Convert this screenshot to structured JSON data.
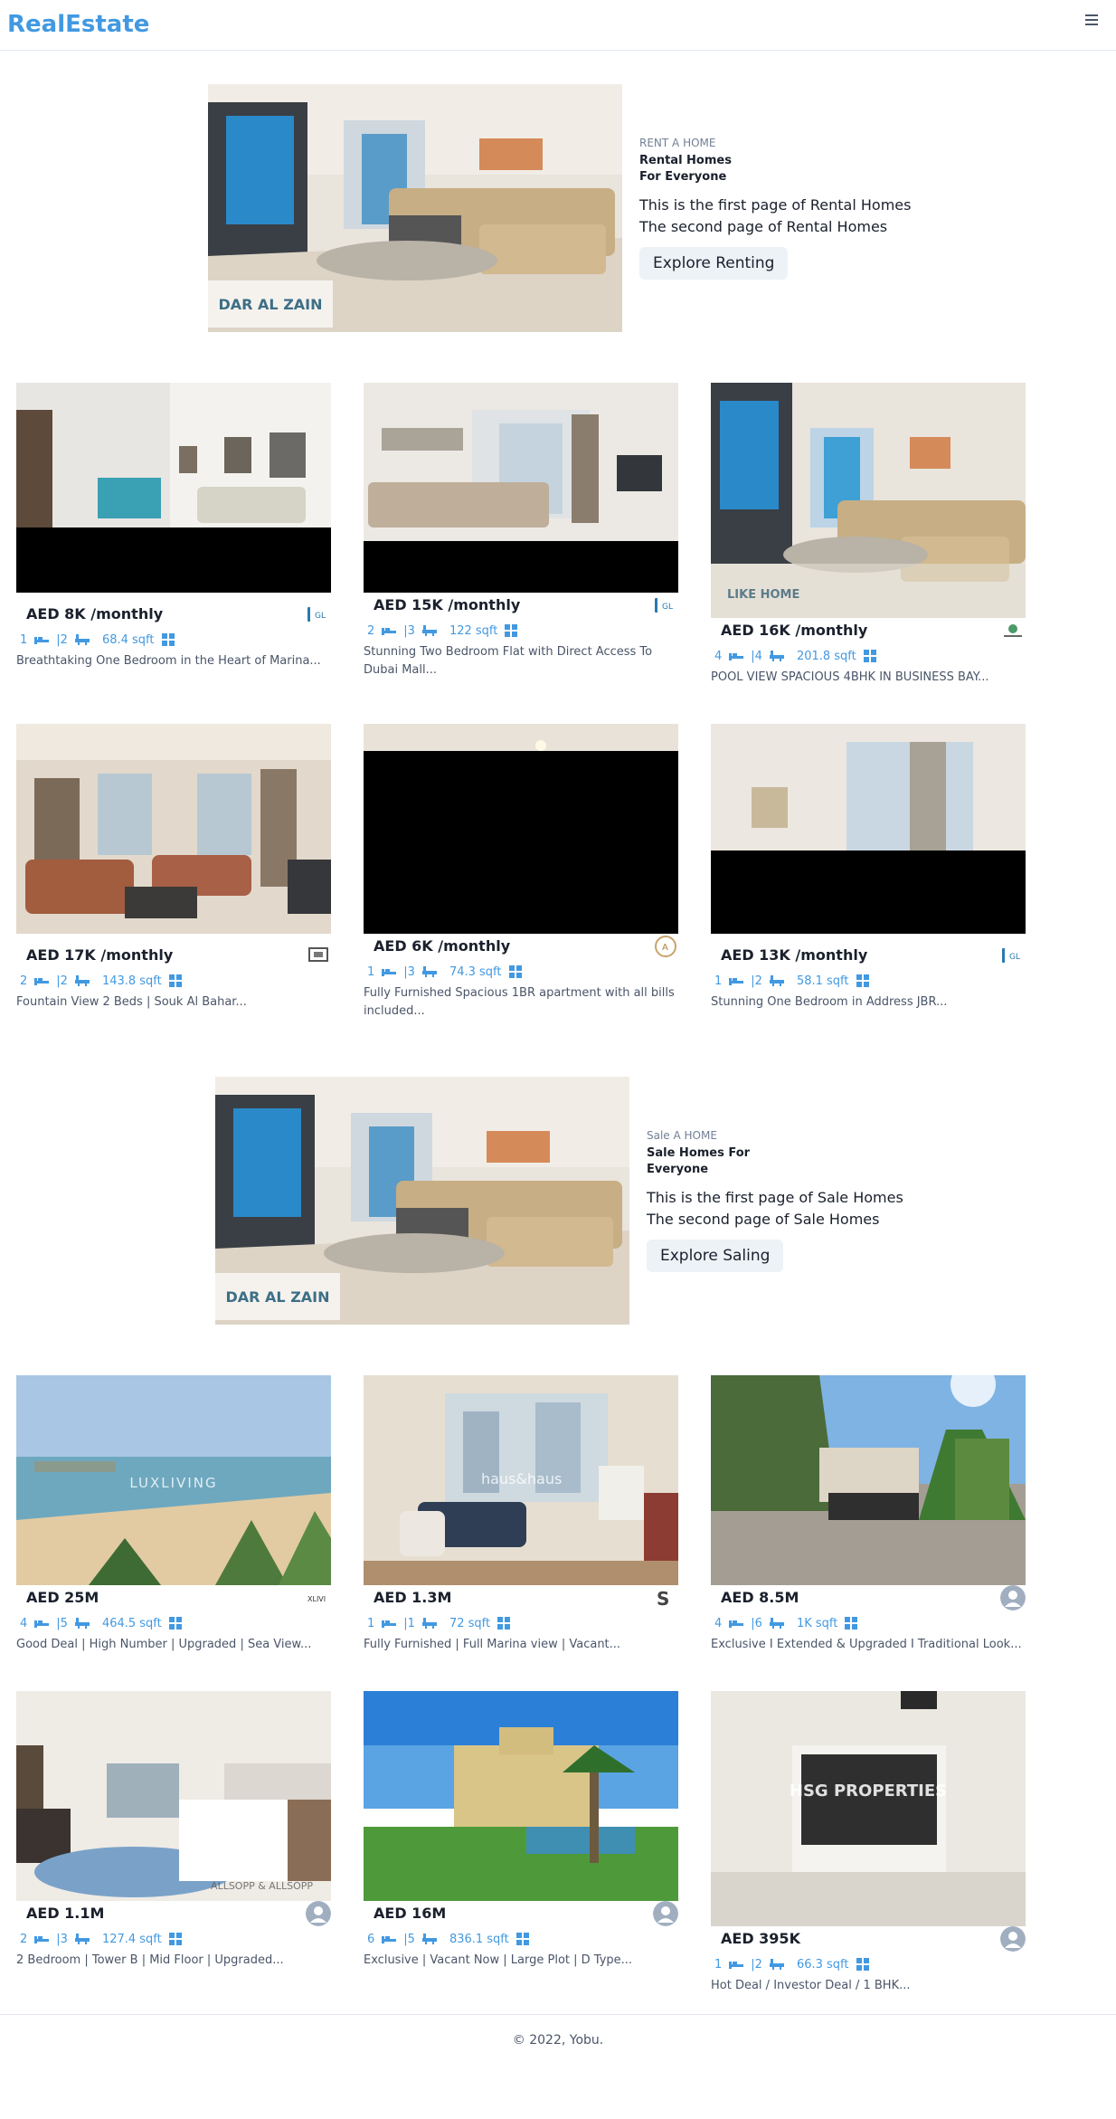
{
  "navbar": {
    "logo": "RealEstate",
    "menu_icon": "hamburger-icon"
  },
  "rent_banner": {
    "purpose": "RENT A HOME",
    "title": "Rental Homes For Everyone",
    "desc1": "This is the first page of Rental Homes",
    "desc2": "The second page of Rental Homes",
    "button": "Explore Renting",
    "watermark": "DAR AL ZAIN"
  },
  "sale_banner": {
    "purpose": "Sale A HOME",
    "title": "Sale Homes For Everyone",
    "desc1": "This is the first page of Sale Homes",
    "desc2": "The second page of Sale Homes",
    "button": "Explore Saling",
    "watermark": "DAR AL ZAIN"
  },
  "rent_cards": [
    {
      "price": "AED 8K /monthly",
      "rooms": "1",
      "baths": "|2",
      "area": "68.4 sqft",
      "title": "Breathtaking One Bedroom in the Heart of Marina...",
      "agency": "logo"
    },
    {
      "price": "AED 15K /monthly",
      "rooms": "2",
      "baths": "|3",
      "area": "122 sqft",
      "title": "Stunning Two Bedroom Flat with Direct Access To Dubai Mall...",
      "agency": "logo"
    },
    {
      "price": "AED 16K /monthly",
      "rooms": "4",
      "baths": "|4",
      "area": "201.8 sqft",
      "title": "POOL VIEW SPACIOUS 4BHK IN BUSINESS BAY...",
      "agency": "logo",
      "watermark": "LIKE HOME"
    },
    {
      "price": "AED 17K /monthly",
      "rooms": "2",
      "baths": "|2",
      "area": "143.8 sqft",
      "title": "Fountain View 2 Beds | Souk Al Bahar...",
      "agency": "logo"
    },
    {
      "price": "AED 6K /monthly",
      "rooms": "1",
      "baths": "|3",
      "area": "74.3 sqft",
      "title": "Fully Furnished Spacious 1BR apartment with all bills included...",
      "agency": "logo"
    },
    {
      "price": "AED 13K /monthly",
      "rooms": "1",
      "baths": "|2",
      "area": "58.1 sqft",
      "title": "Stunning One Bedroom in Address JBR...",
      "agency": "logo"
    }
  ],
  "sale_cards": [
    {
      "price": "AED 25M",
      "rooms": "4",
      "baths": "|5",
      "area": "464.5 sqft",
      "title": "Good Deal | High Number | Upgraded | Sea View...",
      "agency": "logo",
      "watermark": "LUXLIVING"
    },
    {
      "price": "AED 1.3M",
      "rooms": "1",
      "baths": "|1",
      "area": "72 sqft",
      "title": "Fully Furnished | Full Marina view | Vacant...",
      "agency": "logo",
      "watermark": "haus&haus"
    },
    {
      "price": "AED 8.5M",
      "rooms": "4",
      "baths": "|6",
      "area": "1K sqft",
      "title": "Exclusive I Extended & Upgraded I Traditional Look...",
      "agency": "avatar"
    },
    {
      "price": "AED 1.1M",
      "rooms": "2",
      "baths": "|3",
      "area": "127.4 sqft",
      "title": "2 Bedroom | Tower B | Mid Floor | Upgraded...",
      "agency": "avatar",
      "watermark": "ALLSOPP & ALLSOPP"
    },
    {
      "price": "AED 16M",
      "rooms": "6",
      "baths": "|5",
      "area": "836.1 sqft",
      "title": "Exclusive | Vacant Now | Large Plot | D Type...",
      "agency": "avatar"
    },
    {
      "price": "AED 395K",
      "rooms": "1",
      "baths": "|2",
      "area": "66.3 sqft",
      "title": "Hot Deal / Investor Deal / 1 BHK...",
      "agency": "avatar",
      "watermark": "HSG PROPERTIES"
    }
  ],
  "footer": {
    "text": "© 2022, Yobu."
  },
  "colors": {
    "brand": "#4299e1",
    "meta": "#4299e1",
    "text": "#1a202c",
    "muted": "#4a5568"
  }
}
